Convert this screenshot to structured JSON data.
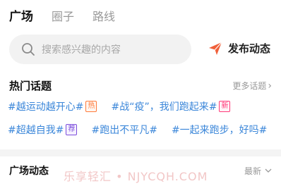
{
  "tabs": [
    {
      "label": "广场",
      "active": true
    },
    {
      "label": "圈子",
      "active": false
    },
    {
      "label": "路线",
      "active": false
    }
  ],
  "search": {
    "placeholder": "搜索感兴趣的内容",
    "icon": "search-icon"
  },
  "publish": {
    "label": "发布动态",
    "icon": "paper-plane-icon",
    "icon_color": "#f0603a"
  },
  "hot_topics": {
    "title": "热门话题",
    "more_label": "更多话题",
    "rows": [
      [
        {
          "text": "#越运动越开心#",
          "badge": "热"
        },
        {
          "text": "#战“疫”，我们跑起来#",
          "badge": "新"
        }
      ],
      [
        {
          "text": "#超越自我#",
          "badge": "荐"
        },
        {
          "text": "#跑出不平凡#",
          "badge": ""
        },
        {
          "text": "#一起来跑步，好吗#",
          "badge": ""
        }
      ]
    ]
  },
  "square_feed": {
    "title": "广场动态",
    "sort_label": "最新"
  },
  "watermark": "乐享轻汇 • NJYCQH.COM",
  "colors": {
    "topic_link": "#3a86d9",
    "badge_hot": "#ff7a3a",
    "badge_new": "#ff3b7a",
    "badge_rec": "#7c4ddb"
  }
}
